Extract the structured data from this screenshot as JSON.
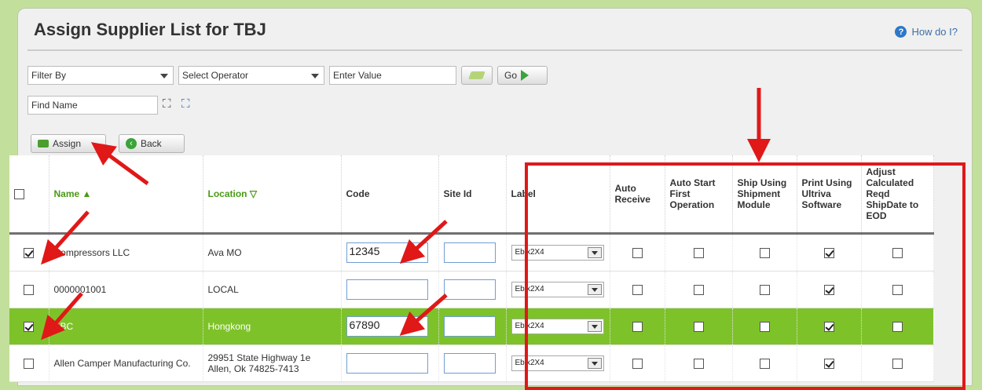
{
  "header": {
    "title": "Assign Supplier List for TBJ",
    "help_label": "How do I?"
  },
  "filter": {
    "filter_by": "Filter By",
    "operator": "Select Operator",
    "value_placeholder": "Enter Value",
    "go_label": "Go",
    "find_name": "Find Name"
  },
  "actions": {
    "assign_label": "Assign",
    "back_label": "Back"
  },
  "table": {
    "columns": {
      "name": "Name ▲",
      "location": "Location ▽",
      "code": "Code",
      "site_id": "Site Id",
      "label": "Label",
      "auto_receive": "Auto Receive",
      "auto_start": "Auto Start First Operation",
      "ship_using": "Ship Using Shipment Module",
      "print_using": "Print Using Ultriva Software",
      "adjust": "Adjust Calculated Reqd ShipDate to EOD"
    },
    "rows": [
      {
        "selected": true,
        "highlight": false,
        "name": "Compressors LLC",
        "location": "Ava MO",
        "code": "12345",
        "site_id": "",
        "label": "Ebix2X4",
        "auto_receive": false,
        "auto_start": false,
        "ship_using": false,
        "print_using": true,
        "adjust": false
      },
      {
        "selected": false,
        "highlight": false,
        "name": "0000001001",
        "location": "LOCAL",
        "code": "",
        "site_id": "",
        "label": "Ebix2X4",
        "auto_receive": false,
        "auto_start": false,
        "ship_using": false,
        "print_using": true,
        "adjust": false
      },
      {
        "selected": true,
        "highlight": true,
        "name": "ABC",
        "location": "Hongkong",
        "code": "67890",
        "site_id": "",
        "label": "Ebix2X4",
        "auto_receive": false,
        "auto_start": false,
        "ship_using": false,
        "print_using": true,
        "adjust": false
      },
      {
        "selected": false,
        "highlight": false,
        "name": "Allen Camper Manufacturing Co.",
        "location": "29951 State Highway 1e Allen, Ok 74825-7413",
        "code": "",
        "site_id": "",
        "label": "Ebix2X4",
        "auto_receive": false,
        "auto_start": false,
        "ship_using": false,
        "print_using": true,
        "adjust": false
      }
    ]
  },
  "colors": {
    "accent_green": "#7ec22a",
    "annotation_red": "#e01818",
    "header_link_green": "#4a9a15"
  }
}
